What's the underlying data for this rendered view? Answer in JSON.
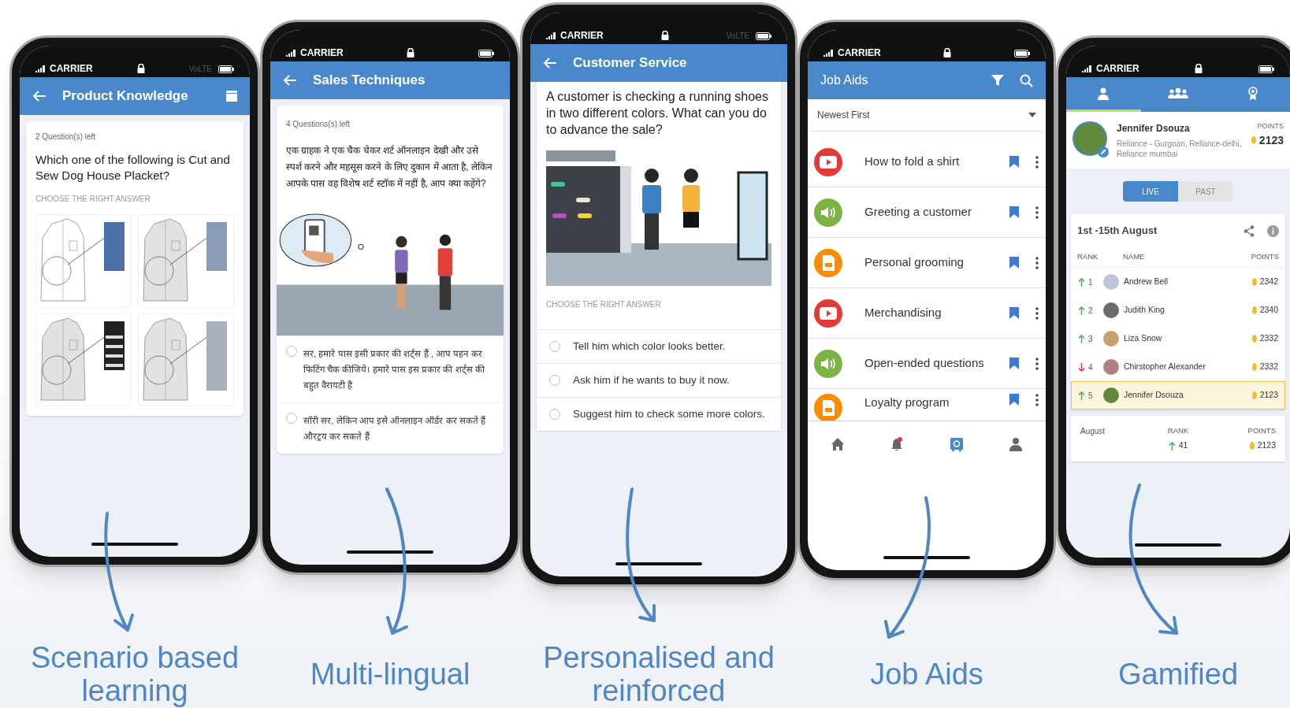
{
  "phones": [
    {
      "kind": "image_quiz",
      "status_bar": {
        "carrier": "CARRIER",
        "network": "VoLTE"
      },
      "header": {
        "title": "Product Knowledge"
      },
      "questions_left": "2 Question(s) left",
      "question": "Which one of the following is Cut and Sew Dog House Placket?",
      "instruction": "CHOOSE THE RIGHT ANSWER",
      "options": [
        {
          "kind": "picture"
        },
        {
          "kind": "picture"
        },
        {
          "kind": "picture"
        },
        {
          "kind": "picture"
        }
      ]
    },
    {
      "kind": "hindi_quiz",
      "status_bar": {
        "carrier": "CARRIER"
      },
      "header": {
        "title": "Sales Techniques"
      },
      "questions_left": "4 Questions(s) left",
      "question": "एक ग्राहक ने एक चैक चेकर शर्ट ऑनलाइन देखी और उसे स्पर्श करने और महसूस करने के लिए दुकान में आता है, लेकिन आपके पास वह विशेष शर्ट स्टॉक में नहीं है, आप क्या कहेंगे?",
      "illustration": {
        "kind": "picture"
      },
      "options": [
        {
          "text": "सर, हमारे पास इसी प्रकार की शर्ट्स हैं , आप पहन कर फिटिंग चैक कीजिये। हमारे पास इस प्रकार की शर्ट्स की बहुत वैरायटी है",
          "selected": false
        },
        {
          "text": "सॉरी सर, लेकिन आप इसे ऑनलाइन ऑर्डर कर सकते हैं औरट्रय कर सकते हैं",
          "selected": false
        }
      ]
    },
    {
      "kind": "scenario_quiz",
      "status_bar": {
        "carrier": "CARRIER",
        "network": "VoLTE"
      },
      "header": {
        "title": "Customer Service"
      },
      "question": "A customer is checking a running shoes in two different colors. What can you do to advance the sale?",
      "illustration": {
        "kind": "picture"
      },
      "instruction": "CHOOSE THE RIGHT ANSWER",
      "options": [
        {
          "text": "Tell him which color looks better.",
          "selected": false
        },
        {
          "text": "Ask him if he wants to buy it now.",
          "selected": false
        },
        {
          "text": "Suggest him to check some more colors.",
          "selected": false
        }
      ]
    },
    {
      "kind": "job_aids",
      "status_bar": {
        "carrier": "CARRIER"
      },
      "header": {
        "title": "Job Aids"
      },
      "sort": {
        "value": "Newest First"
      },
      "items": [
        {
          "kind": "video",
          "title": "How to fold a shirt"
        },
        {
          "kind": "audio",
          "title": "Greeting a customer"
        },
        {
          "kind": "document",
          "title": "Personal grooming"
        },
        {
          "kind": "video",
          "title": "Merchandising"
        },
        {
          "kind": "audio",
          "title": "Open-ended questions"
        },
        {
          "kind": "document",
          "title": "Loyalty program"
        }
      ],
      "nav": [
        {
          "kind": "home",
          "selected": false
        },
        {
          "kind": "notifications",
          "selected": false
        },
        {
          "kind": "library",
          "selected": true
        },
        {
          "kind": "profile",
          "selected": false
        }
      ]
    },
    {
      "kind": "leaderboard",
      "status_bar": {
        "carrier": "CARRIER"
      },
      "tabs": [
        {
          "kind": "profile",
          "selected": true
        },
        {
          "kind": "team",
          "selected": false
        },
        {
          "kind": "awards",
          "selected": false
        }
      ],
      "profile": {
        "name": "Jennifer Dsouza",
        "stores": "Reliance - Gurgoan, Reliance-delhi, Reliance mumbai",
        "points_label": "POINTS",
        "points": "2123"
      },
      "periods": [
        {
          "label": "LIVE",
          "selected": true
        },
        {
          "label": "PAST",
          "selected": false
        }
      ],
      "board": {
        "title": "1st -15th August",
        "columns": [
          "RANK",
          "NAME",
          "POINTS"
        ],
        "rows": [
          {
            "rising": true,
            "rank": "1",
            "name": "Andrew Bell",
            "points": "2342",
            "selected": false
          },
          {
            "rising": true,
            "rank": "2",
            "name": "Judith King",
            "points": "2340",
            "selected": false
          },
          {
            "rising": true,
            "rank": "3",
            "name": "Liza Snow",
            "points": "2332",
            "selected": false
          },
          {
            "rising": false,
            "rank": "4",
            "name": "Chirstopher Alexander",
            "points": "2332",
            "selected": false
          },
          {
            "rising": true,
            "rank": "5",
            "name": "Jennifer Dsouza",
            "points": "2123",
            "selected": true
          }
        ]
      },
      "summary": {
        "period": "August",
        "rank_label": "RANK",
        "rising": true,
        "rank": "41",
        "points_label": "POINTS",
        "points": "2123"
      }
    }
  ],
  "captions": [
    "Scenario based learning",
    "Multi-lingual",
    "Personalised and reinforced",
    "Job Aids",
    "Gamified"
  ]
}
